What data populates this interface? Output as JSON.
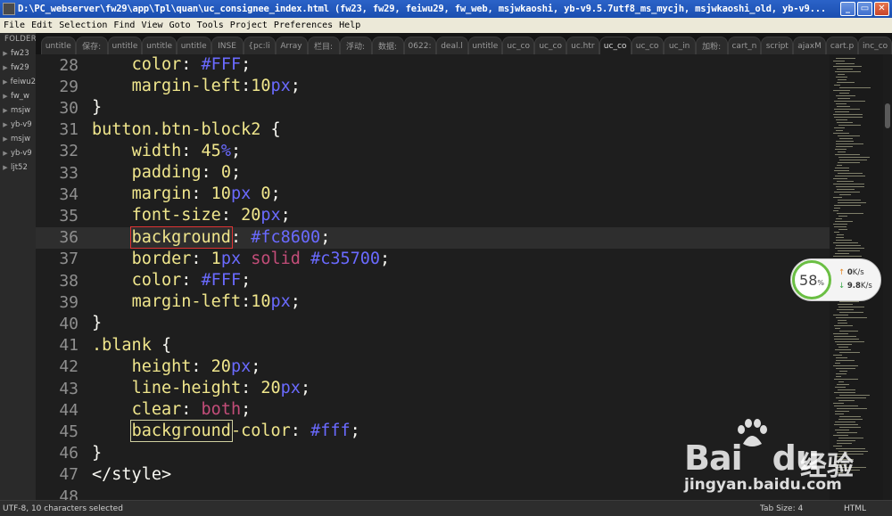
{
  "window": {
    "title": "D:\\PC_webserver\\fw29\\app\\Tpl\\quan\\uc_consignee_index.html (fw23, fw29, feiwu29, fw_web, msjwkaoshi, yb-v9.5.7utf8_ms_mycjh, msjwkaoshi_old, yb-v9...",
    "buttons": {
      "minimize": "_",
      "restore": "▭",
      "close": "✕"
    }
  },
  "menu": [
    "File",
    "Edit",
    "Selection",
    "Find",
    "View",
    "Goto",
    "Tools",
    "Project",
    "Preferences",
    "Help"
  ],
  "sidebar": {
    "header": "FOLDERS",
    "items": [
      "fw23",
      "fw29",
      "feiwu2",
      "fw_w",
      "msjw",
      "yb-v9",
      "msjw",
      "yb-v9",
      "ljt52"
    ]
  },
  "tabs": [
    "untitle",
    "保存:",
    "untitle",
    "untitle",
    "untitle",
    "INSE",
    "{pc:li",
    "Array",
    "栏目:",
    "浮动:",
    "数据:",
    "0622:",
    "deal.l",
    "untitle",
    "uc_co",
    "uc_co",
    "uc.htr",
    "uc_co",
    "uc_co",
    "uc_in",
    "加粉:",
    "cart_n",
    "script",
    "ajaxM",
    "cart.p",
    "inc_co"
  ],
  "active_tab_index": 17,
  "editor": {
    "current_line": "36",
    "lines": [
      {
        "n": "28",
        "tokens": [
          [
            "",
            "    "
          ],
          [
            "c-prop",
            "color"
          ],
          [
            "c-punc",
            ": "
          ],
          [
            "c-hex",
            "#FFF"
          ],
          [
            "c-punc",
            ";"
          ]
        ]
      },
      {
        "n": "29",
        "tokens": [
          [
            "",
            "    "
          ],
          [
            "c-prop",
            "margin-left"
          ],
          [
            "c-punc",
            ":"
          ],
          [
            "c-num",
            "10"
          ],
          [
            "c-unit",
            "px"
          ],
          [
            "c-punc",
            ";"
          ]
        ]
      },
      {
        "n": "30",
        "tokens": [
          [
            "c-punc",
            "}"
          ]
        ]
      },
      {
        "n": "31",
        "tokens": [
          [
            "c-sel",
            "button.btn-block2"
          ],
          [
            "c-punc",
            " {"
          ]
        ]
      },
      {
        "n": "32",
        "tokens": [
          [
            "",
            "    "
          ],
          [
            "c-prop",
            "width"
          ],
          [
            "c-punc",
            ": "
          ],
          [
            "c-num",
            "45"
          ],
          [
            "c-unit",
            "%"
          ],
          [
            "c-punc",
            ";"
          ]
        ]
      },
      {
        "n": "33",
        "tokens": [
          [
            "",
            "    "
          ],
          [
            "c-prop",
            "padding"
          ],
          [
            "c-punc",
            ": "
          ],
          [
            "c-num",
            "0"
          ],
          [
            "c-punc",
            ";"
          ]
        ]
      },
      {
        "n": "34",
        "tokens": [
          [
            "",
            "    "
          ],
          [
            "c-prop",
            "margin"
          ],
          [
            "c-punc",
            ": "
          ],
          [
            "c-num",
            "10"
          ],
          [
            "c-unit",
            "px"
          ],
          [
            "c-punc",
            " "
          ],
          [
            "c-num",
            "0"
          ],
          [
            "c-punc",
            ";"
          ]
        ]
      },
      {
        "n": "35",
        "tokens": [
          [
            "",
            "    "
          ],
          [
            "c-prop",
            "font-size"
          ],
          [
            "c-punc",
            ": "
          ],
          [
            "c-num",
            "20"
          ],
          [
            "c-unit",
            "px"
          ],
          [
            "c-punc",
            ";"
          ]
        ]
      },
      {
        "n": "36",
        "tokens": [
          [
            "",
            "    "
          ],
          [
            "c-prop box-red",
            "background"
          ],
          [
            "c-punc",
            ": "
          ],
          [
            "c-hex",
            "#fc8600"
          ],
          [
            "c-punc",
            ";"
          ]
        ]
      },
      {
        "n": "37",
        "tokens": [
          [
            "",
            "    "
          ],
          [
            "c-prop",
            "border"
          ],
          [
            "c-punc",
            ": "
          ],
          [
            "c-num",
            "1"
          ],
          [
            "c-unit",
            "px"
          ],
          [
            "c-punc",
            " "
          ],
          [
            "c-kw",
            "solid"
          ],
          [
            "c-punc",
            " "
          ],
          [
            "c-hex",
            "#c35700"
          ],
          [
            "c-punc",
            ";"
          ]
        ]
      },
      {
        "n": "38",
        "tokens": [
          [
            "",
            "    "
          ],
          [
            "c-prop",
            "color"
          ],
          [
            "c-punc",
            ": "
          ],
          [
            "c-hex",
            "#FFF"
          ],
          [
            "c-punc",
            ";"
          ]
        ]
      },
      {
        "n": "39",
        "tokens": [
          [
            "",
            "    "
          ],
          [
            "c-prop",
            "margin-left"
          ],
          [
            "c-punc",
            ":"
          ],
          [
            "c-num",
            "10"
          ],
          [
            "c-unit",
            "px"
          ],
          [
            "c-punc",
            ";"
          ]
        ]
      },
      {
        "n": "40",
        "tokens": [
          [
            "c-punc",
            "}"
          ]
        ]
      },
      {
        "n": "41",
        "tokens": [
          [
            "c-sel",
            ".blank"
          ],
          [
            "c-punc",
            " {"
          ]
        ]
      },
      {
        "n": "42",
        "tokens": [
          [
            "",
            "    "
          ],
          [
            "c-prop",
            "height"
          ],
          [
            "c-punc",
            ": "
          ],
          [
            "c-num",
            "20"
          ],
          [
            "c-unit",
            "px"
          ],
          [
            "c-punc",
            ";"
          ]
        ]
      },
      {
        "n": "43",
        "tokens": [
          [
            "",
            "    "
          ],
          [
            "c-prop",
            "line-height"
          ],
          [
            "c-punc",
            ": "
          ],
          [
            "c-num",
            "20"
          ],
          [
            "c-unit",
            "px"
          ],
          [
            "c-punc",
            ";"
          ]
        ]
      },
      {
        "n": "44",
        "tokens": [
          [
            "",
            "    "
          ],
          [
            "c-prop",
            "clear"
          ],
          [
            "c-punc",
            ": "
          ],
          [
            "c-kw",
            "both"
          ],
          [
            "c-punc",
            ";"
          ]
        ]
      },
      {
        "n": "45",
        "tokens": [
          [
            "",
            "    "
          ],
          [
            "c-prop box-light",
            "background"
          ],
          [
            "c-prop",
            "-color"
          ],
          [
            "c-punc",
            ": "
          ],
          [
            "c-hex",
            "#fff"
          ],
          [
            "c-punc",
            ";"
          ]
        ]
      },
      {
        "n": "46",
        "tokens": [
          [
            "c-punc",
            "}"
          ]
        ]
      },
      {
        "n": "47",
        "tokens": [
          [
            "c-punc",
            "</style>"
          ]
        ]
      },
      {
        "n": "48",
        "tokens": []
      }
    ]
  },
  "net_widget": {
    "percent": "58",
    "percent_sign": "%",
    "up_rate": "0",
    "up_unit": "K/s",
    "down_rate": "9.8",
    "down_unit": "K/s"
  },
  "statusbar": {
    "left": "UTF-8, 10 characters selected",
    "tab_size": "Tab Size: 4",
    "syntax": "HTML"
  },
  "watermark": {
    "logo": "Bai",
    "logo_tail": "du",
    "cn": "经验",
    "url": "jingyan.baidu.com"
  },
  "colors": {
    "accent": "#fc8600",
    "border_hex": "#c35700",
    "selection_box": "#e03434"
  }
}
